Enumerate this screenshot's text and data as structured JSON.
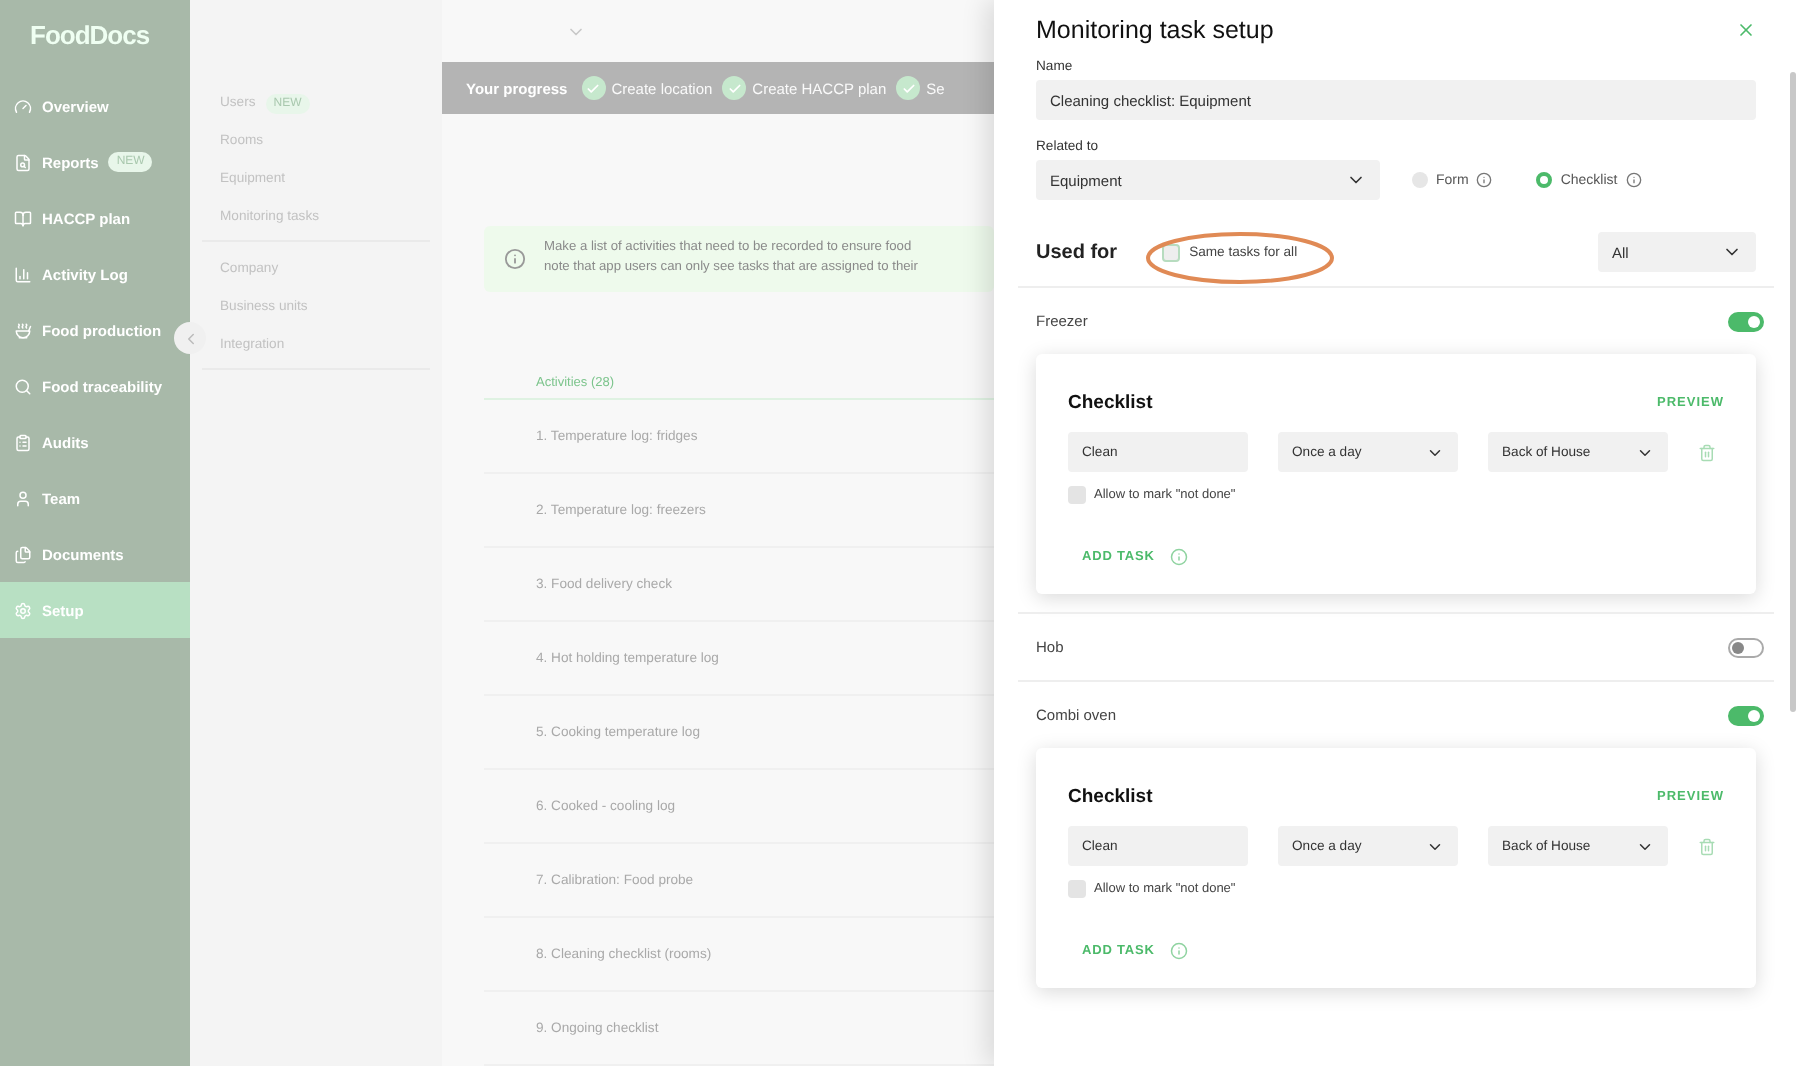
{
  "sidebar": {
    "logo": "FoodDocs",
    "items": [
      {
        "label": "Overview",
        "selected": false
      },
      {
        "label": "Reports",
        "badge": "NEW",
        "selected": false
      },
      {
        "label": "HACCP plan",
        "selected": false
      },
      {
        "label": "Activity Log",
        "selected": false
      },
      {
        "label": "Food production",
        "selected": false
      },
      {
        "label": "Food traceability",
        "selected": false
      },
      {
        "label": "Audits",
        "selected": false
      },
      {
        "label": "Team",
        "selected": false
      },
      {
        "label": "Documents",
        "selected": false
      },
      {
        "label": "Setup",
        "selected": true
      }
    ]
  },
  "submenu": {
    "groups": [
      [
        {
          "label": "Users",
          "badge": "NEW"
        },
        {
          "label": "Rooms"
        },
        {
          "label": "Equipment"
        },
        {
          "label": "Monitoring tasks"
        }
      ],
      [
        {
          "label": "Company"
        },
        {
          "label": "Business units"
        },
        {
          "label": "Integration"
        }
      ]
    ]
  },
  "progress": {
    "title": "Your progress",
    "steps": [
      {
        "label": "Create location",
        "done": true
      },
      {
        "label": "Create HACCP plan",
        "done": true
      },
      {
        "label": "Se",
        "done": true
      }
    ]
  },
  "info": {
    "lines": [
      "Make a list of activities that need to be recorded to ensure food",
      "note that app users can only see tasks that are assigned to their"
    ]
  },
  "activities": {
    "header": "Activities (28)",
    "items": [
      "1. Temperature log: fridges",
      "2. Temperature log: freezers",
      "3. Food delivery check",
      "4. Hot holding temperature log",
      "5. Cooking temperature log",
      "6. Cooked - cooling log",
      "7. Calibration: Food probe",
      "8. Cleaning checklist (rooms)",
      "9. Ongoing checklist"
    ]
  },
  "drawer": {
    "title": "Monitoring task setup",
    "name": {
      "label": "Name",
      "value": "Cleaning checklist: Equipment"
    },
    "related": {
      "label": "Related to",
      "value": "Equipment"
    },
    "types": [
      {
        "label": "Form",
        "selected": false
      },
      {
        "label": "Checklist",
        "selected": true
      }
    ],
    "used_for": {
      "title": "Used for",
      "same_tasks": {
        "label": "Same tasks for all",
        "checked": false,
        "highlighted": true
      },
      "filter": "All"
    },
    "sections": [
      {
        "name": "Freezer",
        "on": true,
        "checklist": {
          "title": "Checklist",
          "preview": "PREVIEW",
          "tasks": [
            {
              "name": "Clean",
              "frequency": "Once a day",
              "area": "Back of House",
              "allow": {
                "label": "Allow to mark \"not done\"",
                "checked": false
              }
            }
          ],
          "add_task": "ADD TASK"
        }
      },
      {
        "name": "Hob",
        "on": false
      },
      {
        "name": "Combi oven",
        "on": true,
        "checklist": {
          "title": "Checklist",
          "preview": "PREVIEW",
          "tasks": [
            {
              "name": "Clean",
              "frequency": "Once a day",
              "area": "Back of House",
              "allow": {
                "label": "Allow to mark \"not done\"",
                "checked": false
              }
            }
          ],
          "add_task": "ADD TASK"
        }
      }
    ]
  }
}
